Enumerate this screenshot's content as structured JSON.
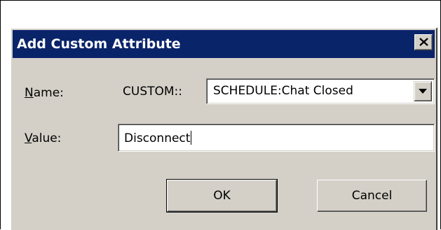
{
  "dialog": {
    "title": "Add Custom Attribute",
    "close_icon": "close-x-icon"
  },
  "form": {
    "name_label_accel": "N",
    "name_label_rest": "ame:",
    "name_prefix": "CUSTOM::",
    "name_selected": "SCHEDULE:Chat Closed",
    "name_dropdown_icon": "chevron-down-icon",
    "value_label_accel": "V",
    "value_label_rest": "alue:",
    "value_text": "Disconnect"
  },
  "buttons": {
    "ok_label": "OK",
    "cancel_label": "Cancel"
  },
  "colors": {
    "titlebar": "#0a246a",
    "dialog_face": "#d4d0c8"
  }
}
